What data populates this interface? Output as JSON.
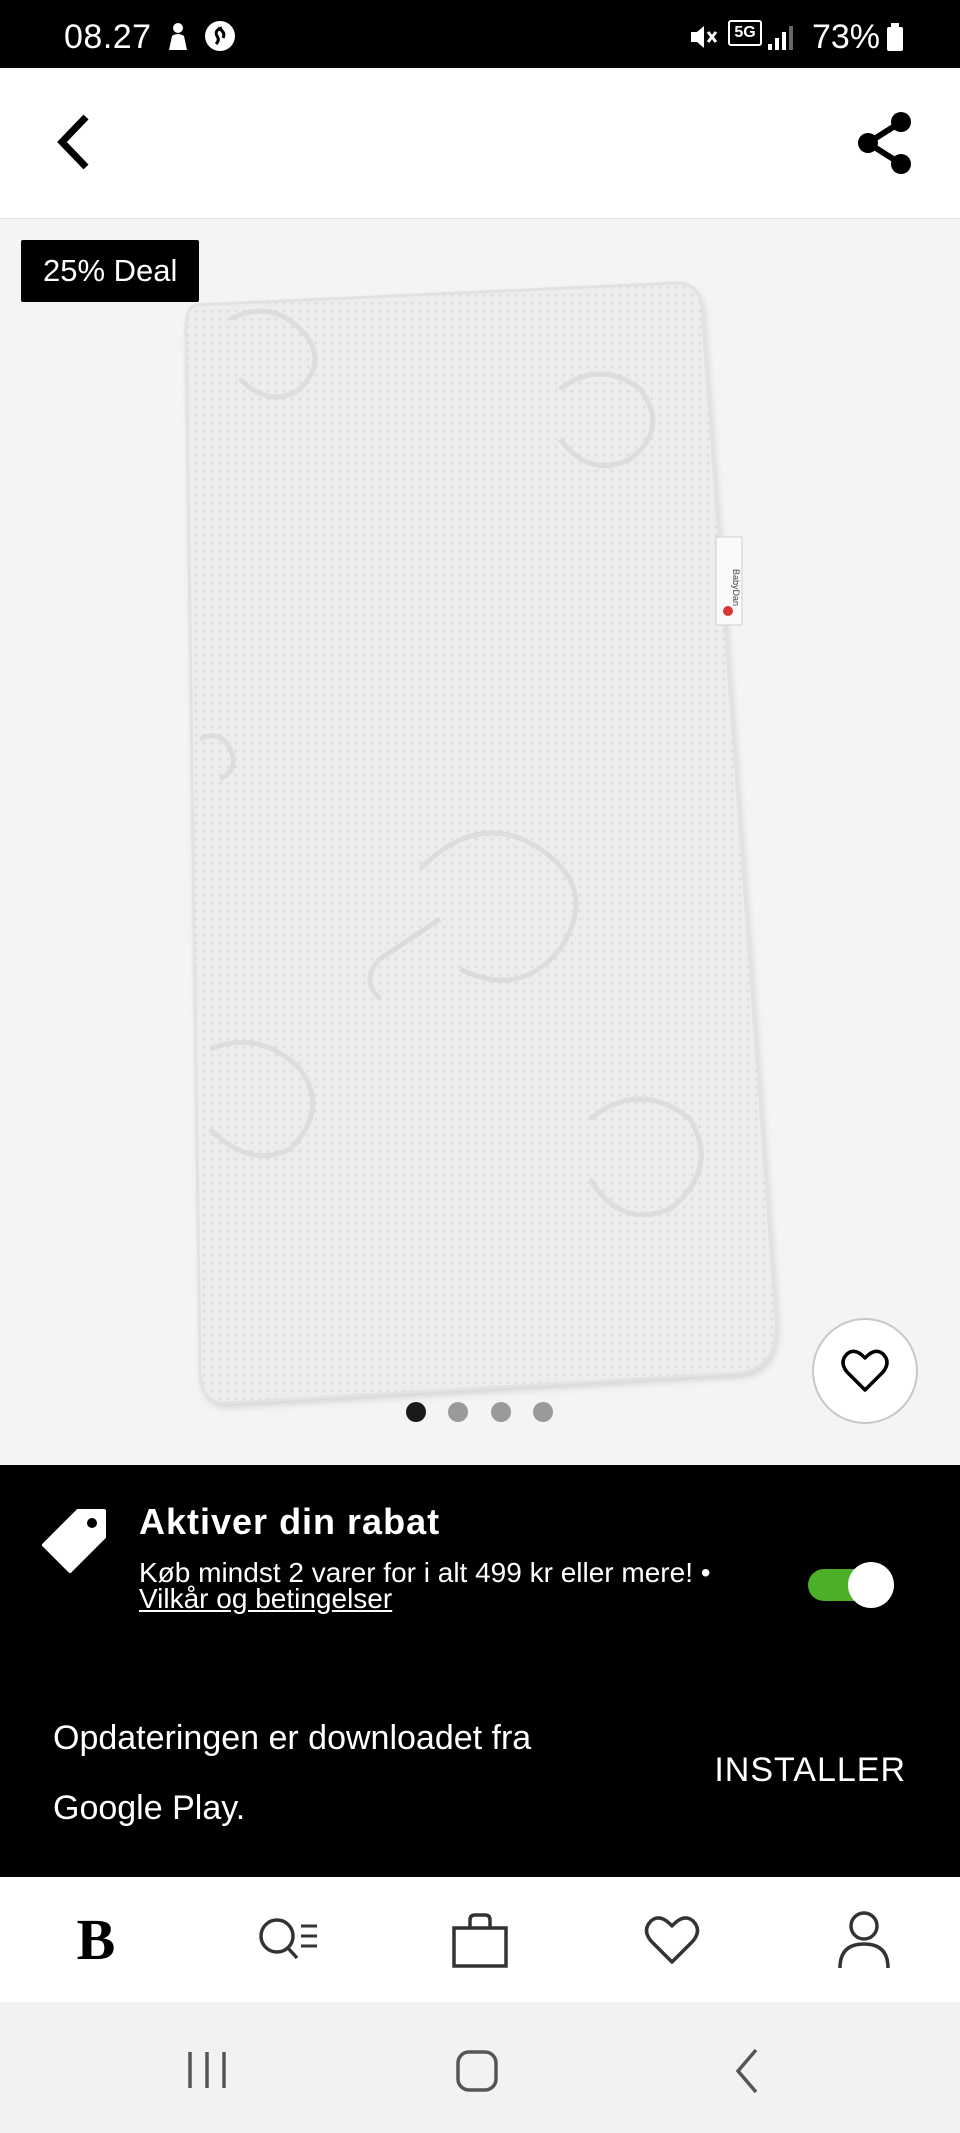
{
  "status_bar": {
    "time": "08.27",
    "battery": "73%",
    "network": "5G",
    "icons": [
      "person-icon",
      "shazam-icon",
      "mute-icon",
      "5g-icon",
      "signal-icon",
      "battery-icon"
    ]
  },
  "app_bar": {
    "icons": [
      "back-icon",
      "share-icon"
    ]
  },
  "product": {
    "deal_badge": "25% Deal",
    "image_label": "BabyDan",
    "image_count": 4,
    "active_image": 1
  },
  "discount": {
    "title": "Aktiver din rabat",
    "description": "Køb mindst 2 varer for i alt 499 kr eller mere! •",
    "terms_link": "Vilkår og betingelser",
    "toggle_on": true,
    "toggle_color": "#4caf28"
  },
  "update_snackbar": {
    "message": "Opdateringen er downloadet fra Google Play.",
    "action": "INSTALLER"
  },
  "bottom_nav": {
    "items": [
      {
        "icon": "home-logo-icon",
        "glyph": "B"
      },
      {
        "icon": "search-list-icon"
      },
      {
        "icon": "bag-icon"
      },
      {
        "icon": "heart-icon"
      },
      {
        "icon": "profile-icon"
      }
    ]
  },
  "system_nav": {
    "icons": [
      "recent-apps-icon",
      "home-icon",
      "system-back-icon"
    ]
  }
}
